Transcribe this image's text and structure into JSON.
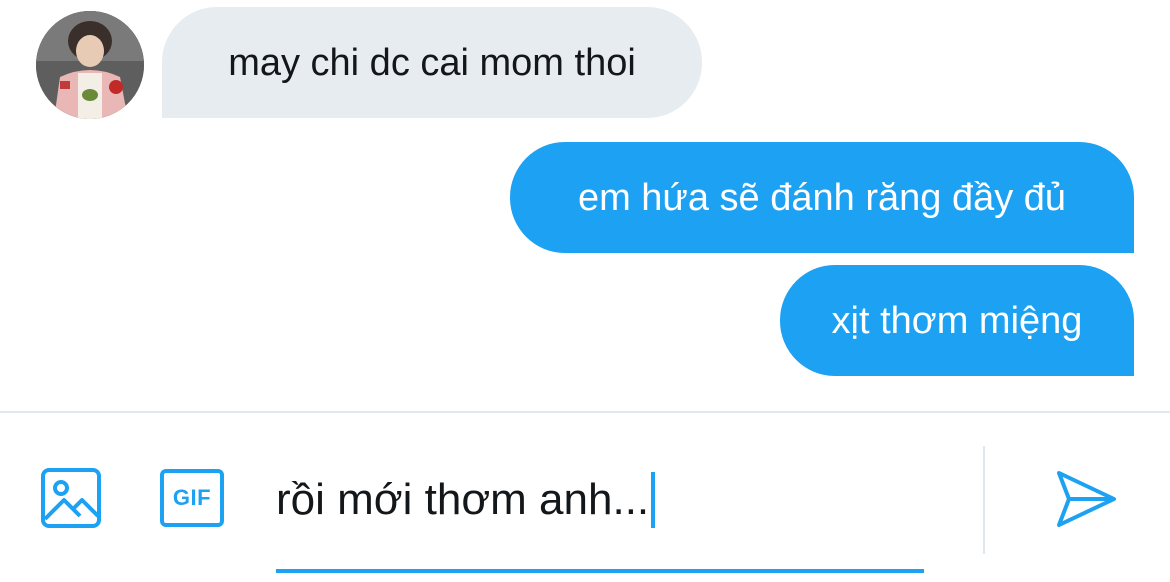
{
  "conversation": {
    "messages": [
      {
        "direction": "received",
        "text": "may chi dc cai mom thoi"
      },
      {
        "direction": "sent",
        "text": "em hứa sẽ đánh răng đầy đủ"
      },
      {
        "direction": "sent",
        "text": "xịt thơm miệng"
      }
    ]
  },
  "composer": {
    "value": "rồi mới thơm anh...",
    "gif_label": "GIF",
    "icons": {
      "image": "image-icon",
      "gif": "gif-icon",
      "send": "send-icon"
    }
  },
  "colors": {
    "accent": "#1da1f2",
    "received_bubble": "#e6ecf0",
    "text": "#14171a",
    "divider": "#e1e8ed"
  }
}
